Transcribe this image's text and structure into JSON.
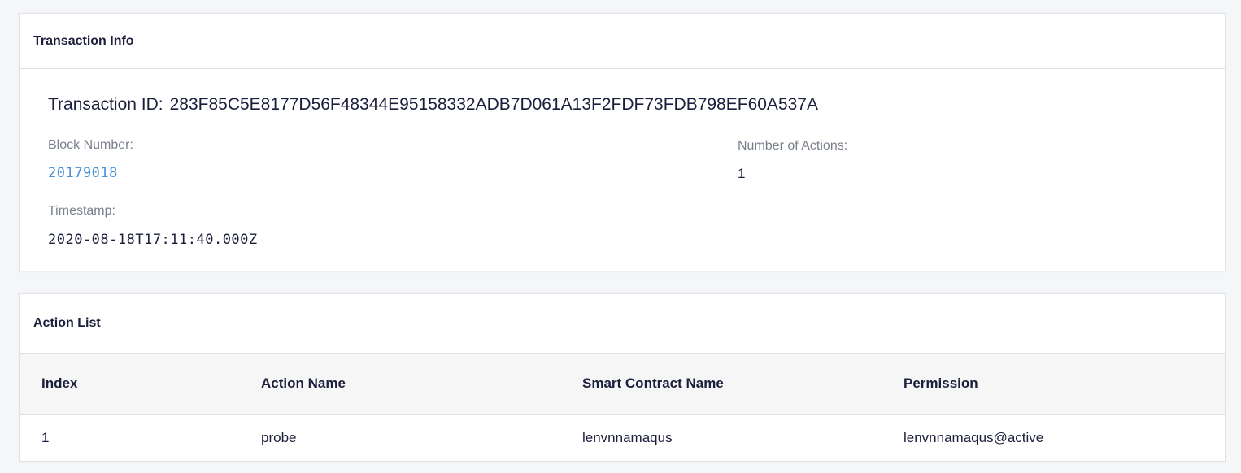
{
  "transaction_info": {
    "title": "Transaction Info",
    "tx_id_label": "Transaction ID:",
    "tx_id": "283F85C5E8177D56F48344E95158332ADB7D061A13F2FDF73FDB798EF60A537A",
    "block_number_label": "Block Number:",
    "block_number": "20179018",
    "num_actions_label": "Number of Actions:",
    "num_actions": "1",
    "timestamp_label": "Timestamp:",
    "timestamp": "2020-08-18T17:11:40.000Z"
  },
  "action_list": {
    "title": "Action List",
    "columns": [
      "Index",
      "Action Name",
      "Smart Contract Name",
      "Permission"
    ],
    "rows": [
      {
        "index": "1",
        "action_name": "probe",
        "contract": "lenvnnamaqus",
        "permission": "lenvnnamaqus@active"
      }
    ]
  },
  "colors": {
    "link": "#4a90d9",
    "text": "#1b1f3b",
    "muted": "#7a7f8c",
    "background": "#f5f6f8"
  }
}
